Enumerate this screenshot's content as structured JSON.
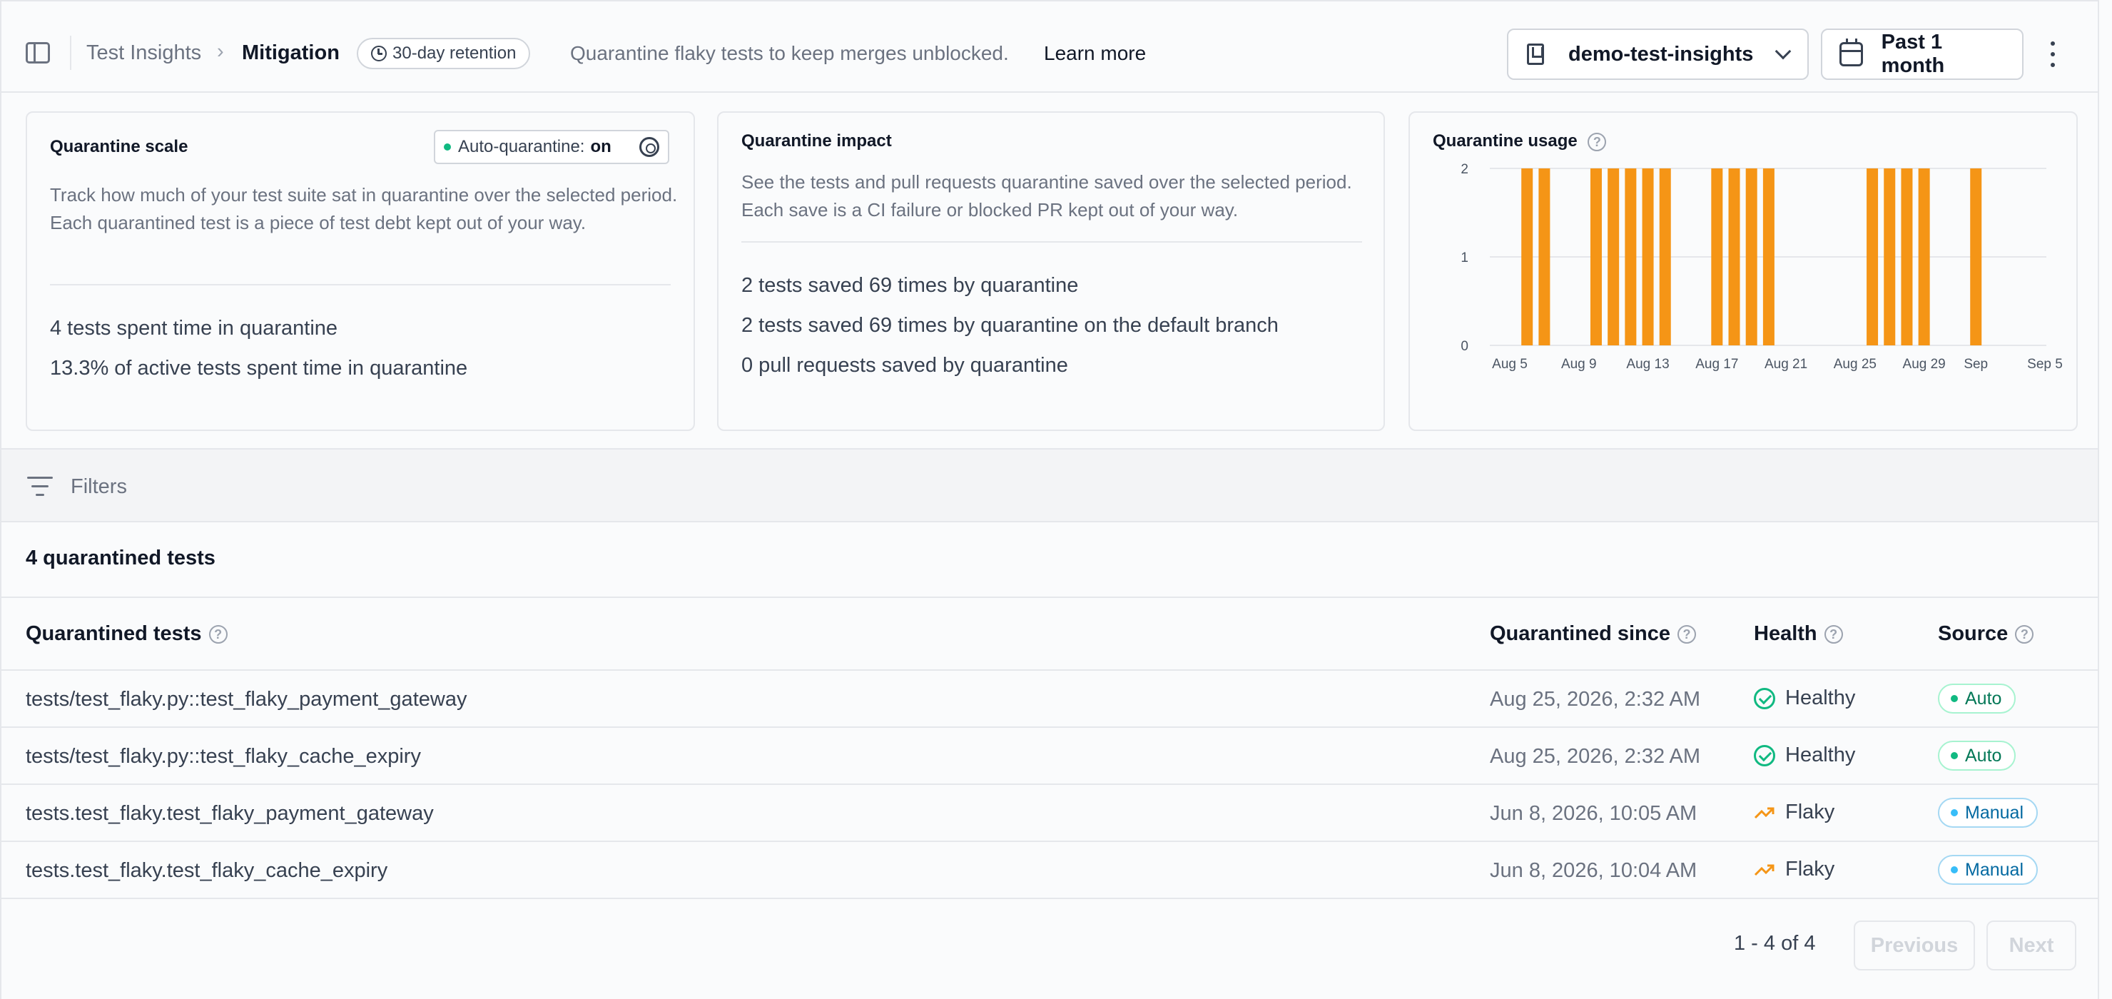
{
  "header": {
    "breadcrumb_root": "Test Insights",
    "breadcrumb_sep": "›",
    "breadcrumb_current": "Mitigation",
    "retention_label": "30-day retention",
    "tagline": "Quarantine flaky tests to keep merges unblocked.",
    "learn_more": "Learn more",
    "repo": "demo-test-insights",
    "date_range": "Past 1 month"
  },
  "scale_card": {
    "title": "Quarantine scale",
    "auto_label": "Auto-quarantine:",
    "auto_value": "on",
    "description": "Track how much of your test suite sat in quarantine over the selected period. Each quarantined test is a piece of test debt kept out of your way.",
    "stats": [
      "4 tests spent time in quarantine",
      "13.3% of active tests spent time in quarantine"
    ]
  },
  "impact_card": {
    "title": "Quarantine impact",
    "description": "See the tests and pull requests quarantine saved over the selected period. Each save is a CI failure or blocked PR kept out of your way.",
    "stats": [
      "2 tests saved 69 times by quarantine",
      "2 tests saved 69 times by quarantine on the default branch",
      "0 pull requests saved by quarantine"
    ]
  },
  "usage_card": {
    "title": "Quarantine usage",
    "help": "?"
  },
  "chart_data": {
    "type": "bar",
    "color": "#f59516",
    "x_start": "Aug 5",
    "x": [
      "Aug 5",
      "Aug 6",
      "Aug 7",
      "Aug 8",
      "Aug 9",
      "Aug 10",
      "Aug 11",
      "Aug 12",
      "Aug 13",
      "Aug 14",
      "Aug 15",
      "Aug 16",
      "Aug 17",
      "Aug 18",
      "Aug 19",
      "Aug 20",
      "Aug 21",
      "Aug 22",
      "Aug 23",
      "Aug 24",
      "Aug 25",
      "Aug 26",
      "Aug 27",
      "Aug 28",
      "Aug 29",
      "Aug 30",
      "Aug 31",
      "Sep 1",
      "Sep 2",
      "Sep 3",
      "Sep 4",
      "Sep 5"
    ],
    "values": [
      0,
      2,
      2,
      0,
      0,
      2,
      2,
      2,
      2,
      2,
      0,
      0,
      2,
      2,
      2,
      2,
      0,
      0,
      0,
      0,
      0,
      2,
      2,
      2,
      2,
      0,
      0,
      2,
      0,
      0,
      0,
      0
    ],
    "ylim": [
      0,
      2
    ],
    "yticks": [
      0,
      1,
      2
    ],
    "xtick_labels": [
      {
        "label": "Aug 5",
        "at": "Aug 5"
      },
      {
        "label": "Aug 9",
        "at": "Aug 9"
      },
      {
        "label": "Aug 13",
        "at": "Aug 13"
      },
      {
        "label": "Aug 17",
        "at": "Aug 17"
      },
      {
        "label": "Aug 21",
        "at": "Aug 21"
      },
      {
        "label": "Aug 25",
        "at": "Aug 25"
      },
      {
        "label": "Aug 29",
        "at": "Aug 29"
      },
      {
        "label": "Sep",
        "at": "Sep 1"
      },
      {
        "label": "Sep 5",
        "at": "Sep 5"
      }
    ],
    "grid": true
  },
  "filters": {
    "label": "Filters"
  },
  "table": {
    "count_label": "4 quarantined tests",
    "columns": [
      "Quarantined tests",
      "Quarantined since",
      "Health",
      "Source"
    ],
    "rows": [
      {
        "name": "tests/test_flaky.py::test_flaky_payment_gateway",
        "since": "Aug 25, 2026, 2:32 AM",
        "health": "Healthy",
        "source": "Auto"
      },
      {
        "name": "tests/test_flaky.py::test_flaky_cache_expiry",
        "since": "Aug 25, 2026, 2:32 AM",
        "health": "Healthy",
        "source": "Auto"
      },
      {
        "name": "tests.test_flaky.test_flaky_payment_gateway",
        "since": "Jun 8, 2026, 10:05 AM",
        "health": "Flaky",
        "source": "Manual"
      },
      {
        "name": "tests.test_flaky.test_flaky_cache_expiry",
        "since": "Jun 8, 2026, 10:04 AM",
        "health": "Flaky",
        "source": "Manual"
      }
    ]
  },
  "pagination": {
    "info": "1 - 4 of 4",
    "previous": "Previous",
    "next": "Next"
  },
  "colors": {
    "healthy": "#10b981",
    "flaky": "#f59516",
    "auto_badge": "#047857",
    "manual_badge": "#0369a1"
  }
}
